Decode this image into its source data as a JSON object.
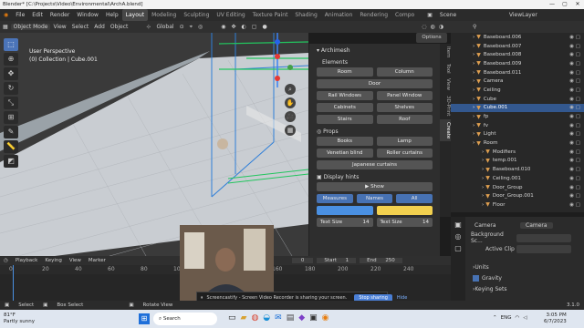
{
  "window": {
    "title": "Blender* [C:\\Projects\\Video\\Environmental\\ArchA.blend]",
    "min": "—",
    "max": "▢",
    "close": "✕"
  },
  "menu": [
    "File",
    "Edit",
    "Render",
    "Window",
    "Help"
  ],
  "workspaces": [
    "Layout",
    "Modeling",
    "Sculpting",
    "UV Editing",
    "Texture Paint",
    "Shading",
    "Animation",
    "Rendering",
    "Compo"
  ],
  "scene": {
    "label": "Scene",
    "viewlayer": "ViewLayer"
  },
  "viewport_header": {
    "mode": "Object Mode",
    "view": "View",
    "select": "Select",
    "add": "Add",
    "object": "Object",
    "orientation": "Global",
    "options": "Options"
  },
  "viewport_info": {
    "line1": "User Perspective",
    "line2": "(0) Collection | Cube.001"
  },
  "archimesh": {
    "title": "Archimesh",
    "elements_label": "Elements",
    "elements": [
      [
        "Room",
        "Column"
      ],
      [
        "Door"
      ],
      [
        "Rail Windows",
        "Panel Window"
      ],
      [
        "Cabinets",
        "Shelves"
      ],
      [
        "Stairs",
        "Roof"
      ]
    ],
    "props_label": "Props",
    "props": [
      [
        "Books",
        "Lamp"
      ],
      [
        "Venetian blind",
        "Roller curtains"
      ],
      [
        "Japanese curtains"
      ]
    ],
    "hints_label": "Display hints",
    "show": "Show",
    "measures": "Measures",
    "names": "Names",
    "all": "All",
    "text_size_label": "Text Size",
    "text_size_1": "14",
    "text_size_2": "14",
    "color_1": "#4a90e2",
    "color_2": "#f2d04f"
  },
  "side_tabs": [
    "Item",
    "Tool",
    "View",
    "3D-Print",
    "Create"
  ],
  "outliner": [
    {
      "name": "Baseboard.006",
      "depth": 1
    },
    {
      "name": "Baseboard.007",
      "depth": 1
    },
    {
      "name": "Baseboard.008",
      "depth": 1
    },
    {
      "name": "Baseboard.009",
      "depth": 1
    },
    {
      "name": "Baseboard.011",
      "depth": 1
    },
    {
      "name": "Camera",
      "depth": 1
    },
    {
      "name": "Ceiling",
      "depth": 1
    },
    {
      "name": "Cube",
      "depth": 1
    },
    {
      "name": "Cube.001",
      "depth": 1,
      "selected": true
    },
    {
      "name": "fp",
      "depth": 1
    },
    {
      "name": "fv",
      "depth": 1
    },
    {
      "name": "Light",
      "depth": 1
    },
    {
      "name": "Room",
      "depth": 1
    },
    {
      "name": "Modifiers",
      "depth": 2
    },
    {
      "name": "temp.001",
      "depth": 2
    },
    {
      "name": "Baseboard.010",
      "depth": 2
    },
    {
      "name": "Ceiling.001",
      "depth": 2
    },
    {
      "name": "Door_Group",
      "depth": 2
    },
    {
      "name": "Door_Group.001",
      "depth": 2
    },
    {
      "name": "Floor",
      "depth": 2
    }
  ],
  "properties": {
    "camera": "Camera",
    "camera_value": "Camera",
    "background": "Background Sc...",
    "active_clip": "Active Clip",
    "units": "Units",
    "gravity": "Gravity",
    "keying_sets": "Keying Sets"
  },
  "timeline": {
    "playback": "Playback",
    "keying": "Keying",
    "view": "View",
    "marker": "Marker",
    "current": "0",
    "start_label": "Start",
    "start": "1",
    "end_label": "End",
    "end": "250",
    "ticks": [
      "0",
      "20",
      "40",
      "60",
      "80",
      "100",
      "120",
      "140",
      "160",
      "180",
      "200",
      "220",
      "240"
    ]
  },
  "status": {
    "select": "Select",
    "box_select": "Box Select",
    "rotate_view": "Rotate View",
    "version": "3.1.0"
  },
  "share_bar": {
    "text": "Screencastify - Screen Video Recorder is sharing your screen.",
    "stop": "Stop sharing",
    "hide": "Hide"
  },
  "taskbar": {
    "weather_temp": "81°F",
    "weather_desc": "Partly sunny",
    "search": "Search",
    "lang": "ENG",
    "time": "3:05 PM",
    "date": "6/7/2023"
  }
}
